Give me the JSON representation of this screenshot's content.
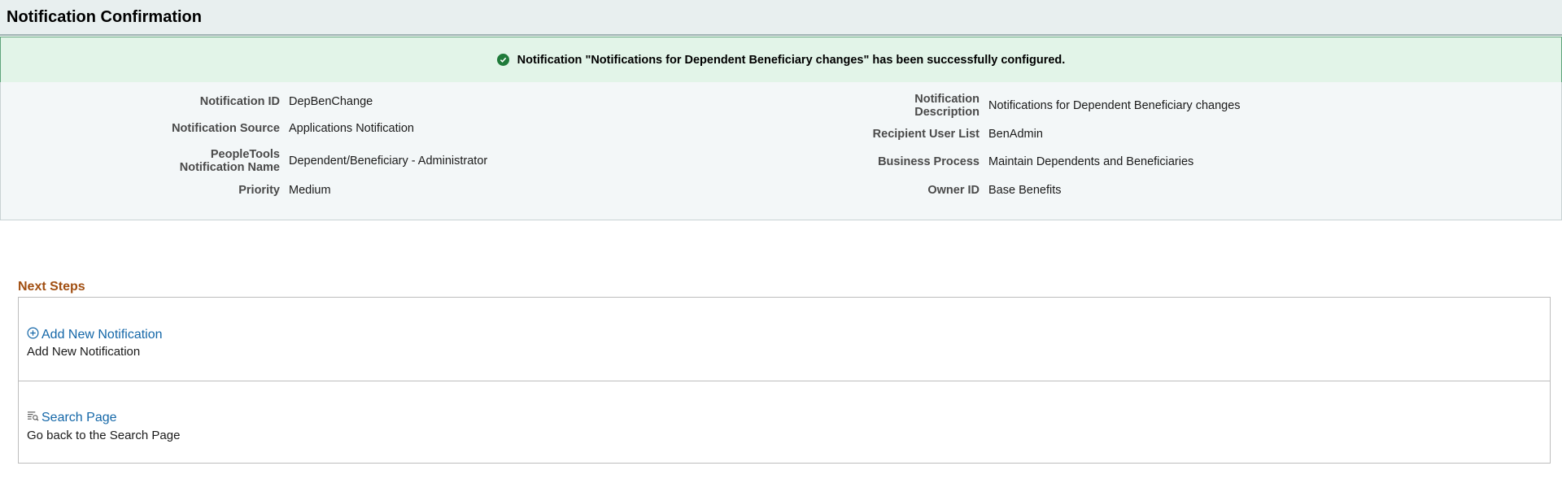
{
  "header": {
    "title": "Notification Confirmation"
  },
  "banner": {
    "icon": "check-circle-icon",
    "message": "Notification \"Notifications for Dependent Beneficiary changes\" has been successfully configured."
  },
  "details": {
    "left": [
      {
        "label": "Notification ID",
        "value": "DepBenChange"
      },
      {
        "label": "Notification Source",
        "value": "Applications Notification"
      },
      {
        "label_line1": "PeopleTools",
        "label_line2": "Notification Name",
        "value": "Dependent/Beneficiary - Administrator"
      },
      {
        "label": "Priority",
        "value": "Medium"
      }
    ],
    "right": [
      {
        "label_line1": "Notification",
        "label_line2": "Description",
        "value": "Notifications for Dependent Beneficiary changes"
      },
      {
        "label": "Recipient User List",
        "value": "BenAdmin"
      },
      {
        "label": "Business Process",
        "value": "Maintain Dependents and Beneficiaries"
      },
      {
        "label": "Owner ID",
        "value": "Base Benefits"
      }
    ]
  },
  "next_steps": {
    "title": "Next Steps",
    "items": [
      {
        "icon": "add-circle-icon",
        "link": "Add New Notification",
        "description": "Add New Notification"
      },
      {
        "icon": "search-list-icon",
        "link": "Search Page",
        "description": "Go back to the Search Page"
      }
    ]
  },
  "colors": {
    "banner_bg": "#e2f4e8",
    "link": "#1467a8",
    "section_title": "#a14f12",
    "success": "#1f7a3a"
  }
}
